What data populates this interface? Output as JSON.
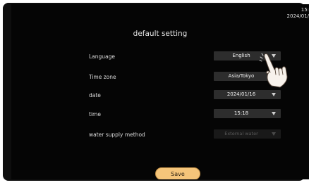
{
  "status": {
    "time": "15:",
    "date": "2024/01/"
  },
  "page": {
    "title": "default setting"
  },
  "settings": [
    {
      "label": "Language",
      "value": "English",
      "enabled": true
    },
    {
      "label": "Time zone",
      "value": "Asia/Tokyo",
      "enabled": true
    },
    {
      "label": "date",
      "value": "2024/01/16",
      "enabled": true
    },
    {
      "label": "time",
      "value": "15:18",
      "enabled": true
    },
    {
      "label": "water supply method",
      "value": "External water",
      "enabled": false
    }
  ],
  "actions": {
    "save_label": "Save"
  },
  "colors": {
    "background": "#050505",
    "select_bg": "#2d2d2d",
    "save_button": "#f5c57a"
  },
  "icons": [
    "dropdown-caret-icon",
    "pointing-hand-icon"
  ]
}
